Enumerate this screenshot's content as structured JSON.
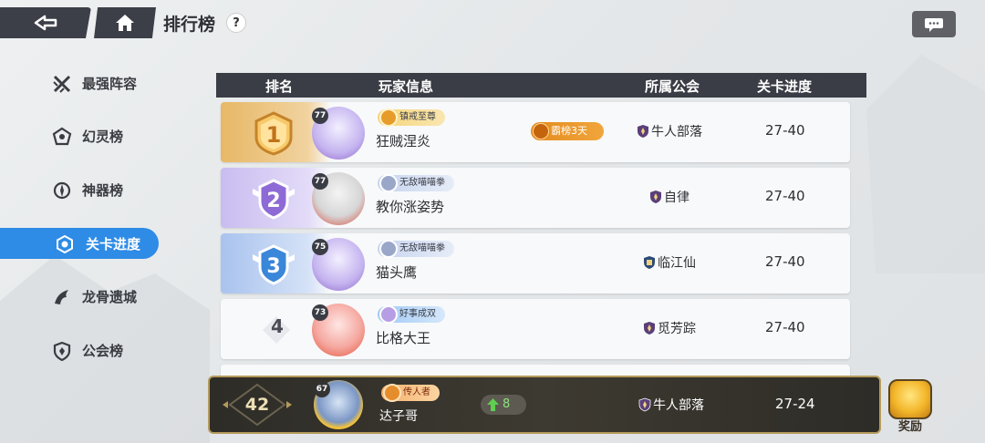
{
  "header": {
    "title": "排行榜",
    "help": "?"
  },
  "sidebar": {
    "items": [
      {
        "label": "最强阵容",
        "icon": "swords-icon"
      },
      {
        "label": "幻灵榜",
        "icon": "spirit-icon"
      },
      {
        "label": "神器榜",
        "icon": "artifact-icon"
      },
      {
        "label": "关卡进度",
        "icon": "stage-icon",
        "active": true
      },
      {
        "label": "龙骨遗城",
        "icon": "dragon-icon"
      },
      {
        "label": "公会榜",
        "icon": "guild-shield-icon"
      }
    ]
  },
  "table": {
    "columns": [
      "排名",
      "玩家信息",
      "所属公会",
      "关卡进度"
    ],
    "rows": [
      {
        "rank": "1",
        "level": "77",
        "title": "镇戒至尊",
        "name": "狂贼涅炎",
        "honor": "霸榜3天",
        "guild": "牛人部落",
        "progress": "27-40"
      },
      {
        "rank": "2",
        "level": "77",
        "title": "无敌喵喵拳",
        "name": "教你涨姿势",
        "guild": "自律",
        "progress": "27-40"
      },
      {
        "rank": "3",
        "level": "75",
        "title": "无敌喵喵拳",
        "name": "猫头鹰",
        "guild": "临江仙",
        "progress": "27-40"
      },
      {
        "rank": "4",
        "level": "73",
        "title": "好事成双",
        "name": "比格大王",
        "guild": "觅芳踪",
        "progress": "27-40"
      }
    ]
  },
  "my_rank": {
    "rank": "42",
    "level": "67",
    "title": "传人者",
    "name": "达子哥",
    "change": "8",
    "guild": "牛人部落",
    "progress": "27-24"
  },
  "reward": {
    "label": "奖励"
  },
  "colors": {
    "accent": "#2e8be6",
    "header_bg": "#3a3d45",
    "gold": "#e6b35a",
    "silver_purple": "#b9a8e6",
    "bronze_blue": "#8fb2e6"
  }
}
